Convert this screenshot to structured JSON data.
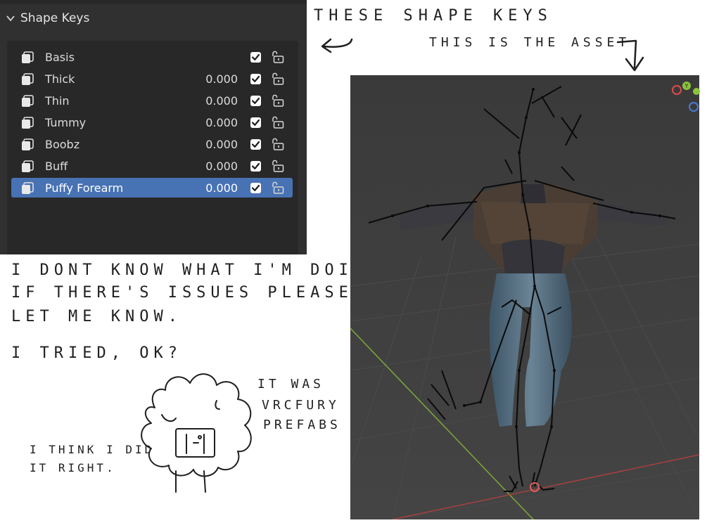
{
  "panel": {
    "title": "Shape Keys",
    "chevron_icon": "chevron-down-icon",
    "shape_keys": [
      {
        "name": "Basis",
        "value": "",
        "checked": true,
        "selected": false
      },
      {
        "name": "Thick",
        "value": "0.000",
        "checked": true,
        "selected": false
      },
      {
        "name": "Thin",
        "value": "0.000",
        "checked": true,
        "selected": false
      },
      {
        "name": "Tummy",
        "value": "0.000",
        "checked": true,
        "selected": false
      },
      {
        "name": "Boobz",
        "value": "0.000",
        "checked": true,
        "selected": false
      },
      {
        "name": "Buff",
        "value": "0.000",
        "checked": true,
        "selected": false
      },
      {
        "name": "Puffy Forearm",
        "value": "0.000",
        "checked": true,
        "selected": true
      }
    ],
    "colors": {
      "panel_bg": "#303030",
      "list_bg": "#282828",
      "selected": "#4772b3"
    }
  },
  "notes": {
    "shapekeys": "THESE SHAPE KEYS",
    "asset": "THIS IS THE ASSET",
    "line1": "I DONT KNOW WHAT I'M DOING.",
    "line2": "IF THERE'S ISSUES PLEASE",
    "line3": "LET ME KNOW.",
    "tried": "I TRIED, OK?",
    "was1": "IT WAS",
    "was2": "VRCFURY",
    "was3": "PREFABS",
    "think1": "I THINK I DID",
    "think2": "IT RIGHT."
  },
  "viewport": {
    "bg": "#3b3b3b",
    "axis_colors": {
      "x": "#e04a4a",
      "y": "#8ac43a",
      "z": "#4a7ad8"
    },
    "gizmo_labels": {
      "y": "Y"
    }
  }
}
